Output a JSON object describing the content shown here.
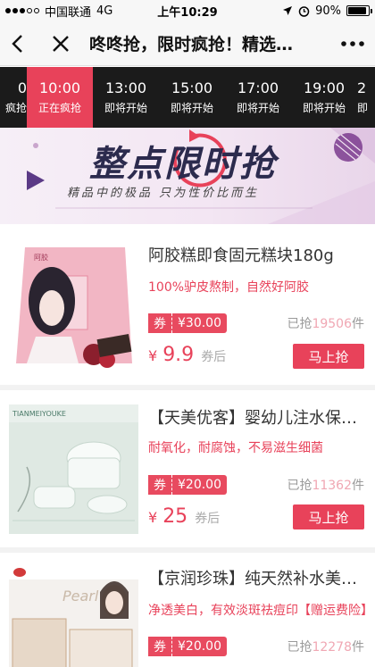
{
  "status_bar": {
    "carrier": "中国联通",
    "network": "4G",
    "time": "上午10:29",
    "battery": "90%",
    "battery_level": 0.9
  },
  "nav": {
    "title": "咚咚抢，限时疯抢！精选…"
  },
  "time_tabs": [
    {
      "time": "0",
      "status": "疯抢",
      "active": false
    },
    {
      "time": "10:00",
      "status": "正在疯抢",
      "active": true
    },
    {
      "time": "13:00",
      "status": "即将开始",
      "active": false
    },
    {
      "time": "15:00",
      "status": "即将开始",
      "active": false
    },
    {
      "time": "17:00",
      "status": "即将开始",
      "active": false
    },
    {
      "time": "19:00",
      "status": "即将开始",
      "active": false
    },
    {
      "time": "2",
      "status": "即",
      "active": false
    }
  ],
  "banner": {
    "title": "整点限时抢",
    "subtitle": "精品中的极品  只为性价比而生"
  },
  "products": [
    {
      "title": "阿胶糕即食固元糕块180g",
      "desc": "100%驴皮熬制，自然好阿胶",
      "coupon_label": "券",
      "coupon_value": "¥30.00",
      "sold_prefix": "已抢",
      "sold_count": "19506",
      "sold_suffix": "件",
      "price_symbol": "¥",
      "price": "9.9",
      "price_suffix": "券后",
      "buy_label": "马上抢"
    },
    {
      "title": "【天美优客】婴幼儿注水保…",
      "desc": "耐氧化，耐腐蚀，不易滋生细菌",
      "coupon_label": "券",
      "coupon_value": "¥20.00",
      "sold_prefix": "已抢",
      "sold_count": "11362",
      "sold_suffix": "件",
      "price_symbol": "¥",
      "price": "25",
      "price_suffix": "券后",
      "buy_label": "马上抢"
    },
    {
      "title": "【京润珍珠】纯天然补水美…",
      "desc": "净透美白，有效淡斑祛痘印【赠运费险】",
      "coupon_label": "券",
      "coupon_value": "¥20.00",
      "sold_prefix": "已抢",
      "sold_count": "12278",
      "sold_suffix": "件"
    }
  ],
  "colors": {
    "accent": "#e8425a",
    "tab_bar": "#1b1b1b"
  }
}
